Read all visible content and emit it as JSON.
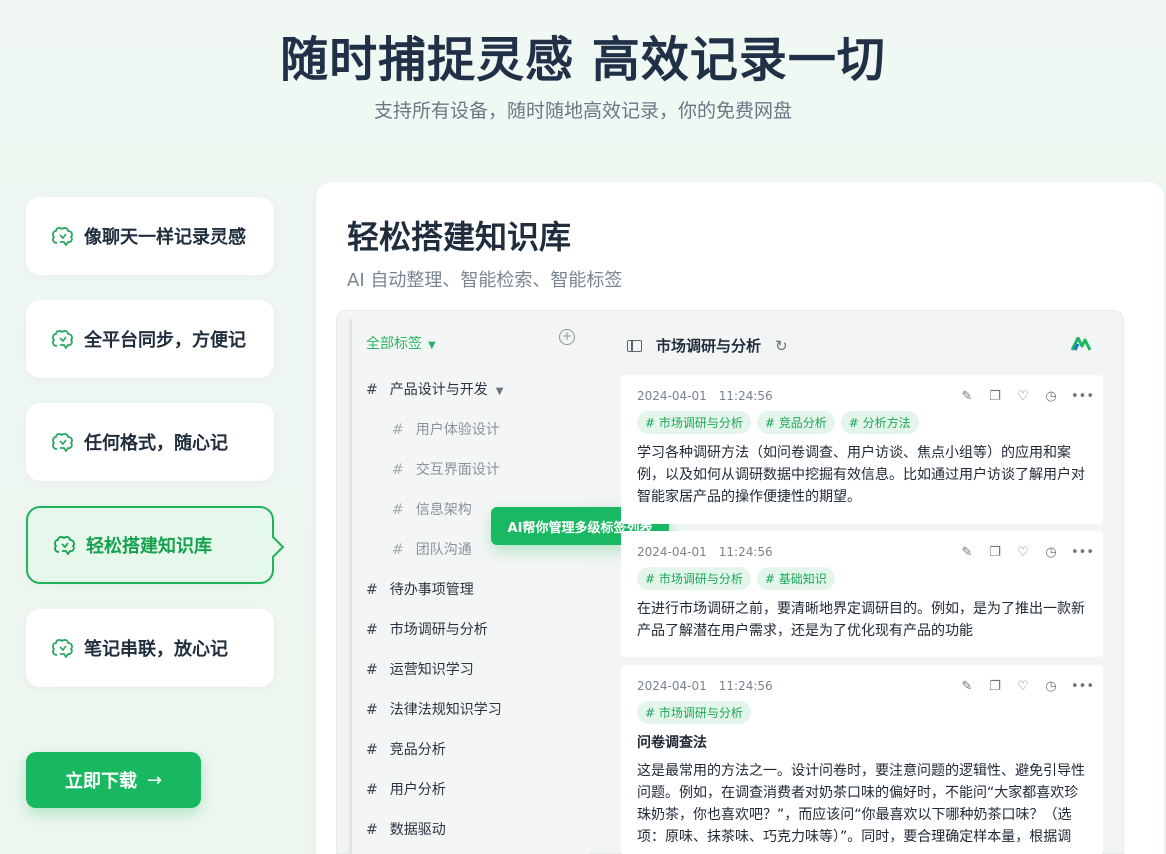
{
  "hero": {
    "title": "随时捕捉灵感 高效记录一切",
    "subtitle": "支持所有设备，随时随地高效记录，你的免费网盘"
  },
  "features": [
    {
      "label": "像聊天一样记录灵感",
      "icon": "brain-icon"
    },
    {
      "label": "全平台同步，方便记",
      "icon": "brain-icon"
    },
    {
      "label": "任何格式，随心记",
      "icon": "brain-icon"
    },
    {
      "label": "轻松搭建知识库",
      "icon": "brain-icon",
      "active": true
    },
    {
      "label": "笔记串联，放心记",
      "icon": "brain-icon"
    }
  ],
  "download": {
    "label": "立即下载",
    "arrow": "→"
  },
  "panel": {
    "title": "轻松搭建知识库",
    "subtitle": "AI 自动整理、智能检索、智能标签"
  },
  "sidebar": {
    "header": "全部标签",
    "tags": [
      {
        "label": "产品设计与开发",
        "level": 0,
        "expandable": true
      },
      {
        "label": "用户体验设计",
        "level": 1
      },
      {
        "label": "交互界面设计",
        "level": 1
      },
      {
        "label": "信息架构",
        "level": 1
      },
      {
        "label": "团队沟通",
        "level": 1
      },
      {
        "label": "待办事项管理",
        "level": 0
      },
      {
        "label": "市场调研与分析",
        "level": 0
      },
      {
        "label": "运营知识学习",
        "level": 0
      },
      {
        "label": "法律法规知识学习",
        "level": 0
      },
      {
        "label": "竞品分析",
        "level": 0
      },
      {
        "label": "用户分析",
        "level": 0
      },
      {
        "label": "数据驱动",
        "level": 0
      }
    ]
  },
  "tooltip": "AI帮你管理多级标签列表",
  "content": {
    "title": "市场调研与分析",
    "notes": [
      {
        "date": "2024-04-01",
        "time": "11:24:56",
        "tags": [
          "# 市场调研与分析",
          "# 竞品分析",
          "# 分析方法"
        ],
        "heading": "",
        "body": "学习各种调研方法（如问卷调查、用户访谈、焦点小组等）的应用和案例，以及如何从调研数据中挖掘有效信息。比如通过用户访谈了解用户对智能家居产品的操作便捷性的期望。"
      },
      {
        "date": "2024-04-01",
        "time": "11:24:56",
        "tags": [
          "# 市场调研与分析",
          "# 基础知识"
        ],
        "heading": "",
        "body": "在进行市场调研之前，要清晰地界定调研目的。例如，是为了推出一款新产品了解潜在用户需求，还是为了优化现有产品的功能"
      },
      {
        "date": "2024-04-01",
        "time": "11:24:56",
        "tags": [
          "# 市场调研与分析"
        ],
        "heading": "问卷调查法",
        "body": "这是最常用的方法之一。设计问卷时，要注意问题的逻辑性、避免引导性问题。例如，在调查消费者对奶茶口味的偏好时，不能问“大家都喜欢珍珠奶茶，你也喜欢吧？”，而应该问“你最喜欢以下哪种奶茶口味？（选项：原味、抹茶味、巧克力味等）”。同时，要合理确定样本量，根据调"
      }
    ],
    "actions": [
      "edit-icon",
      "copy-icon",
      "heart-icon",
      "alarm-icon",
      "more-icon"
    ]
  },
  "colors": {
    "accent": "#17b85f",
    "accent_light": "#e4f6eb",
    "title": "#1f3047"
  }
}
